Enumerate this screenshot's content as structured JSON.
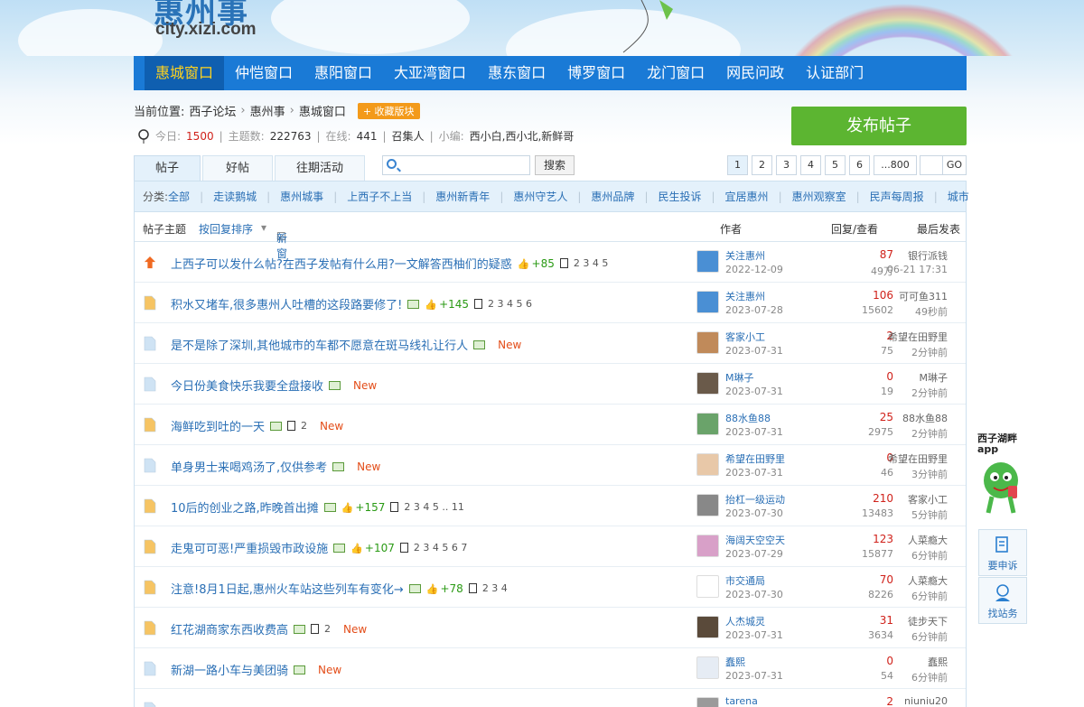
{
  "header": {
    "logo_text": "惠州事",
    "logo_url_text": "city.xizi.com"
  },
  "nav": [
    "惠城窗口",
    "仲恺窗口",
    "惠阳窗口",
    "大亚湾窗口",
    "惠东窗口",
    "博罗窗口",
    "龙门窗口",
    "网民问政",
    "认证部门"
  ],
  "breadcrumb": {
    "label": "当前位置:",
    "items": [
      "西子论坛",
      "惠州事",
      "惠城窗口"
    ],
    "fav": "+ 收藏版块"
  },
  "stats": {
    "today_label": "今日:",
    "today": "1500",
    "topics_label": "主题数:",
    "topics": "222763",
    "online_label": "在线:",
    "online": "441",
    "convener": "召集人",
    "editors_label": "小编:",
    "editors": "西小白,西小北,新鲜哥"
  },
  "post_button": "发布帖子",
  "tabs": [
    "帖子",
    "好帖",
    "往期活动"
  ],
  "search": {
    "button": "搜索",
    "placeholder": ""
  },
  "pagination": {
    "pages": [
      "1",
      "2",
      "3",
      "4",
      "5",
      "6",
      "...800"
    ],
    "go": "GO"
  },
  "categories": {
    "label": "分类:",
    "items": [
      "全部",
      "走读鹅城",
      "惠州城事",
      "上西子不上当",
      "惠州新青年",
      "惠州守艺人",
      "惠州品牌",
      "民生投诉",
      "宜居惠州",
      "惠州观察室",
      "民声每周报",
      "城市"
    ]
  },
  "table_header": {
    "topic": "帖子主题",
    "sort": "按回复排序",
    "new_window": "新窗",
    "author": "作者",
    "reply_view": "回复/查看",
    "last_post": "最后发表"
  },
  "threads": [
    {
      "title": "上西子可以发什么帖?在西子发帖有什么用?一文解答西柚们的疑惑",
      "likes": "+85",
      "pages": "2 3 4 5",
      "author": "关注惠州",
      "date": "2022-12-09",
      "replies": "87",
      "views": "49万",
      "last_user": "银行派钱",
      "last_time": "06-21 17:31"
    },
    {
      "title": "积水又堵车,很多惠州人吐槽的这段路要修了!",
      "likes": "+145",
      "pages": "2 3 4 5 6",
      "author": "关注惠州",
      "date": "2023-07-28",
      "replies": "106",
      "views": "15602",
      "last_user": "可可鱼311",
      "last_time": "49秒前"
    },
    {
      "title": "是不是除了深圳,其他城市的车都不愿意在斑马线礼让行人",
      "new": "New",
      "author": "客家小工",
      "date": "2023-07-31",
      "replies": "2",
      "views": "75",
      "last_user": "希望在田野里",
      "last_time": "2分钟前"
    },
    {
      "title": "今日份美食快乐我要全盘接收",
      "new": "New",
      "author": "M琳子",
      "date": "2023-07-31",
      "replies": "0",
      "views": "19",
      "last_user": "M琳子",
      "last_time": "2分钟前"
    },
    {
      "title": "海鲜吃到吐的一天",
      "pages": "2",
      "new": "New",
      "author": "88水鱼88",
      "date": "2023-07-31",
      "replies": "25",
      "views": "2975",
      "last_user": "88水鱼88",
      "last_time": "2分钟前"
    },
    {
      "title": "单身男士来喝鸡汤了,仅供参考",
      "new": "New",
      "author": "希望在田野里",
      "date": "2023-07-31",
      "replies": "0",
      "views": "46",
      "last_user": "希望在田野里",
      "last_time": "3分钟前"
    },
    {
      "title": "10后的创业之路,昨晚首出摊",
      "likes": "+157",
      "pages": "2 3 4 5 .. 11",
      "author": "抬杠一级运动",
      "date": "2023-07-30",
      "replies": "210",
      "views": "13483",
      "last_user": "客家小工",
      "last_time": "5分钟前"
    },
    {
      "title": "走鬼可可恶!严重损毁市政设施",
      "likes": "+107",
      "pages": "2 3 4 5 6 7",
      "author": "海阔天空空天",
      "date": "2023-07-29",
      "replies": "123",
      "views": "15877",
      "last_user": "人菜瘾大",
      "last_time": "6分钟前"
    },
    {
      "title": "注意!8月1日起,惠州火车站这些列车有变化→",
      "likes": "+78",
      "pages": "2 3 4",
      "author": "市交通局",
      "date": "2023-07-30",
      "replies": "70",
      "views": "8226",
      "last_user": "人菜瘾大",
      "last_time": "6分钟前"
    },
    {
      "title": "红花湖商家东西收费高",
      "pages": "2",
      "new": "New",
      "author": "人杰城灵",
      "date": "2023-07-31",
      "replies": "31",
      "views": "3634",
      "last_user": "徒步天下",
      "last_time": "6分钟前"
    },
    {
      "title": "新湖一路小车与美团骑",
      "new": "New",
      "author": "蠢熙",
      "date": "2023-07-31",
      "replies": "0",
      "views": "54",
      "last_user": "蠢熙",
      "last_time": "6分钟前"
    },
    {
      "author": "tarena",
      "replies": "2",
      "last_user": "niuniu20"
    }
  ],
  "side": {
    "app_title": "西子湖畔",
    "app_sub": "app",
    "complain": "要申诉",
    "find_staff": "找站务"
  }
}
